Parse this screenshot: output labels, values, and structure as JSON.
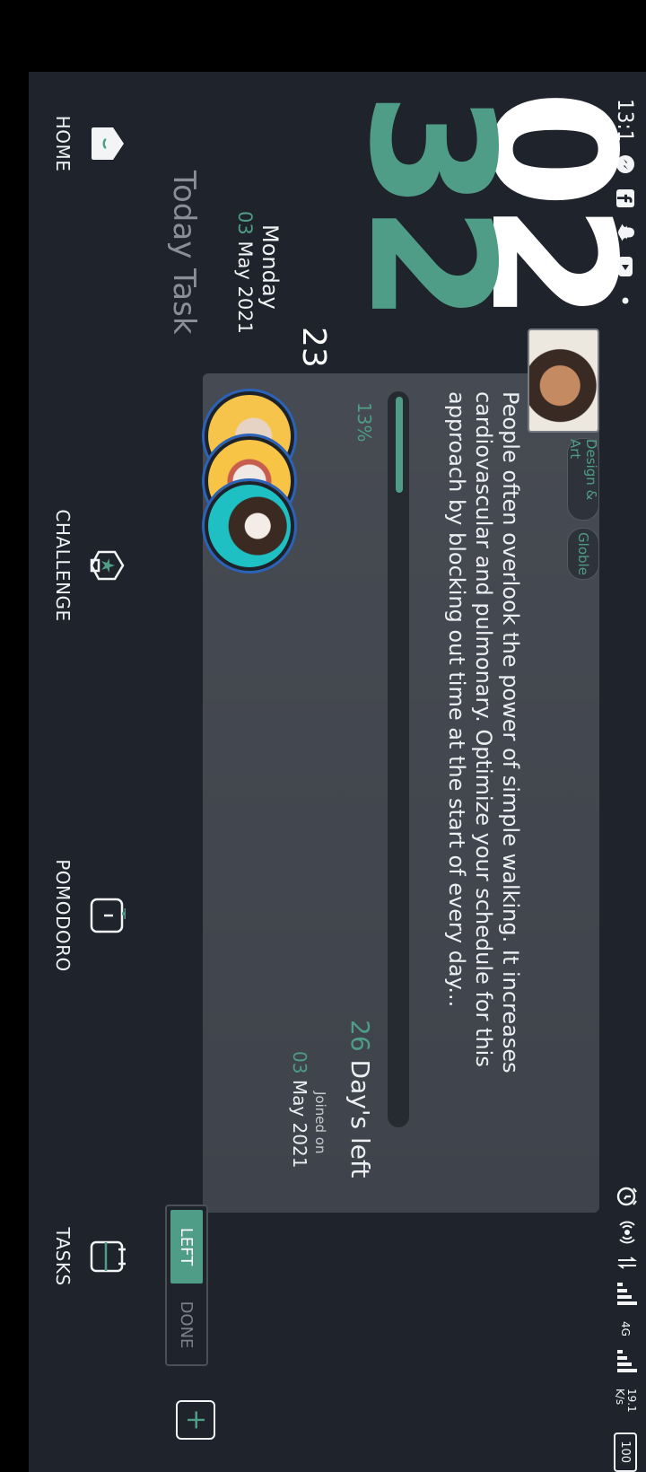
{
  "status_bar": {
    "time": "13:1",
    "network_speed": "19.1\nK/s",
    "network_type": "4G",
    "battery": "100",
    "icons": [
      "messenger-icon",
      "facebook-icon",
      "notification-icon",
      "youtube-icon",
      "alarm-icon",
      "hotspot-icon",
      "signal-icon",
      "battery-icon"
    ]
  },
  "clock": {
    "hour": "02",
    "minute": "32",
    "second": "23",
    "day": "Monday",
    "date_day": "03",
    "date_rest": "May 2021"
  },
  "section_title": "Today Task",
  "task_card": {
    "tags": [
      "Design & Art",
      "Globle"
    ],
    "description": "People often overlook the power of simple walking. It increases cardiovascular and pulmonary. Optimize your schedule for this approach by blocking out time at the start of every day...",
    "progress": 0.13,
    "progress_label": "13%",
    "days_left_number": "26",
    "days_left_text": "Day's left",
    "joined_label": "Joined on",
    "joined_day": "03",
    "joined_rest": "May 2021"
  },
  "toggle": {
    "left_label": "LEFT",
    "done_label": "DONE",
    "active": "LEFT"
  },
  "nav": {
    "home": "HOME",
    "challenge": "CHALLENGE",
    "pomodoro": "POMODORO",
    "tasks": "TASKS"
  },
  "colors": {
    "accent": "#4f9c87",
    "background": "#1f232b",
    "card": "#3f434b"
  }
}
